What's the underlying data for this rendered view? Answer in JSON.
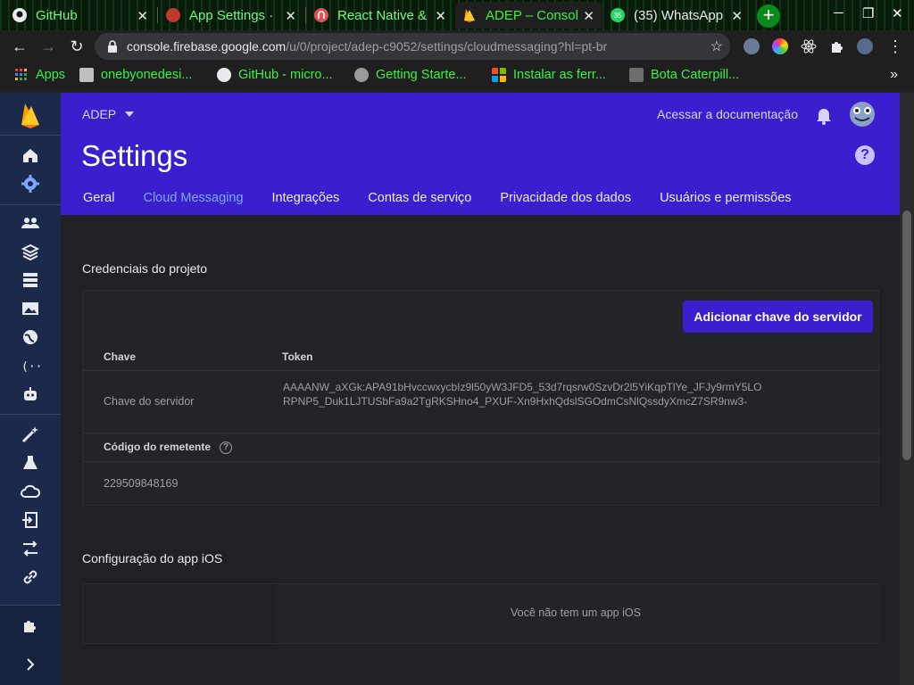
{
  "browser": {
    "tabs": [
      {
        "title": "GitHub",
        "icon": "github-icon"
      },
      {
        "title": "App Settings ·",
        "icon": "expo-icon"
      },
      {
        "title": "React Native &",
        "icon": "react-native-icon"
      },
      {
        "title": "ADEP – Consol",
        "icon": "firebase-icon"
      },
      {
        "title": "(35) WhatsApp",
        "icon": "whatsapp-icon"
      }
    ],
    "close_glyph": "✕",
    "new_tab": "+",
    "url_host": "console.firebase.google.com",
    "url_path": "/u/0/project/adep-c9052/settings/cloudmessaging?hl=pt-br",
    "bookmarks": [
      {
        "label": "Apps"
      },
      {
        "label": "onebyonedesi..."
      },
      {
        "label": "GitHub - micro..."
      },
      {
        "label": "Getting Starte..."
      },
      {
        "label": "Instalar as ferr..."
      },
      {
        "label": "Bota Caterpill..."
      }
    ],
    "more_glyph": "»"
  },
  "header": {
    "project": "ADEP",
    "docs_link": "Acessar a documentação",
    "title": "Settings",
    "help": "?",
    "tabs": [
      {
        "label": "Geral"
      },
      {
        "label": "Cloud Messaging"
      },
      {
        "label": "Integrações"
      },
      {
        "label": "Contas de serviço"
      },
      {
        "label": "Privacidade dos dados"
      },
      {
        "label": "Usuários e permissões"
      }
    ]
  },
  "credentials": {
    "section_title": "Credenciais do projeto",
    "add_key_button": "Adicionar chave do servidor",
    "col_key": "Chave",
    "col_token": "Token",
    "server_key_label": "Chave do servidor",
    "server_key_token": "AAAANW_aXGk:APA91bHvccwxycbIz9l50yW3JFD5_53d7rqsrw0SzvDr2l5YiKqpTlYe_JFJy9rmY5LORPNP5_Duk1LJTUSbFa9a2TgRKSHno4_PXUF-Xn9HxhQdslSGOdmCsNlQssdyXmcZ7SR9nw3-",
    "sender_label": "Código do remetente",
    "sender_help": "?",
    "sender_id": "229509848169"
  },
  "ios": {
    "section_title": "Configuração do app iOS",
    "empty_message": "Você não tem um app iOS"
  },
  "colors": {
    "accent": "#3b1fcf",
    "rail": "#1b2a4a",
    "tab_link_selected": "#7aa9ff",
    "terminal_green": "#3df04a"
  }
}
